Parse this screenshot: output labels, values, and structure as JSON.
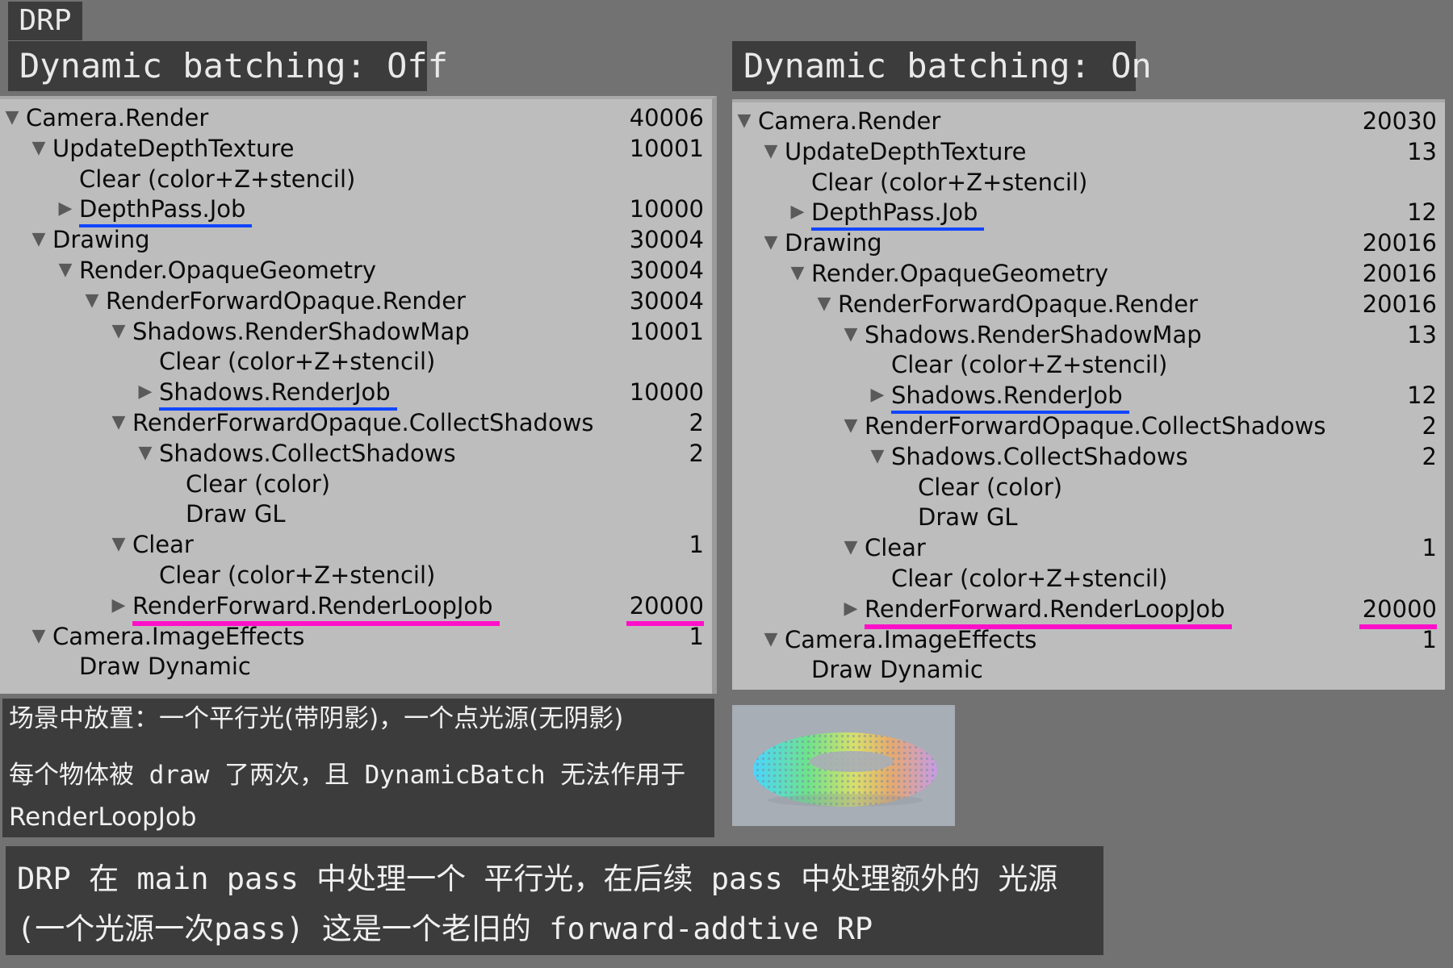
{
  "header": {
    "drp_label": "DRP"
  },
  "panels": [
    {
      "title": "Dynamic batching: Off",
      "rows": [
        {
          "indent": 0,
          "toggle": "expanded",
          "name": "Camera.Render",
          "count": "40006",
          "mark": ""
        },
        {
          "indent": 1,
          "toggle": "expanded",
          "name": "UpdateDepthTexture",
          "count": "10001",
          "mark": ""
        },
        {
          "indent": 2,
          "toggle": "none",
          "name": "Clear (color+Z+stencil)",
          "count": "",
          "mark": ""
        },
        {
          "indent": 2,
          "toggle": "collapsed",
          "name": "DepthPass.Job",
          "count": "10000",
          "mark": "blue"
        },
        {
          "indent": 1,
          "toggle": "expanded",
          "name": "Drawing",
          "count": "30004",
          "mark": ""
        },
        {
          "indent": 2,
          "toggle": "expanded",
          "name": "Render.OpaqueGeometry",
          "count": "30004",
          "mark": ""
        },
        {
          "indent": 3,
          "toggle": "expanded",
          "name": "RenderForwardOpaque.Render",
          "count": "30004",
          "mark": ""
        },
        {
          "indent": 4,
          "toggle": "expanded",
          "name": "Shadows.RenderShadowMap",
          "count": "10001",
          "mark": ""
        },
        {
          "indent": 5,
          "toggle": "none",
          "name": "Clear (color+Z+stencil)",
          "count": "",
          "mark": ""
        },
        {
          "indent": 5,
          "toggle": "collapsed",
          "name": "Shadows.RenderJob",
          "count": "10000",
          "mark": "blue"
        },
        {
          "indent": 4,
          "toggle": "expanded",
          "name": "RenderForwardOpaque.CollectShadows",
          "count": "2",
          "mark": ""
        },
        {
          "indent": 5,
          "toggle": "expanded",
          "name": "Shadows.CollectShadows",
          "count": "2",
          "mark": ""
        },
        {
          "indent": 6,
          "toggle": "none",
          "name": "Clear (color)",
          "count": "",
          "mark": ""
        },
        {
          "indent": 6,
          "toggle": "none",
          "name": "Draw GL",
          "count": "",
          "mark": ""
        },
        {
          "indent": 4,
          "toggle": "expanded",
          "name": "Clear",
          "count": "1",
          "mark": ""
        },
        {
          "indent": 5,
          "toggle": "none",
          "name": "Clear (color+Z+stencil)",
          "count": "",
          "mark": ""
        },
        {
          "indent": 4,
          "toggle": "collapsed",
          "name": "RenderForward.RenderLoopJob",
          "count": "20000",
          "mark": "pink"
        },
        {
          "indent": 1,
          "toggle": "expanded",
          "name": "Camera.ImageEffects",
          "count": "1",
          "mark": ""
        },
        {
          "indent": 2,
          "toggle": "none",
          "name": "Draw Dynamic",
          "count": "",
          "mark": ""
        }
      ]
    },
    {
      "title": "Dynamic batching: On",
      "rows": [
        {
          "indent": 0,
          "toggle": "expanded",
          "name": "Camera.Render",
          "count": "20030",
          "mark": ""
        },
        {
          "indent": 1,
          "toggle": "expanded",
          "name": "UpdateDepthTexture",
          "count": "13",
          "mark": ""
        },
        {
          "indent": 2,
          "toggle": "none",
          "name": "Clear (color+Z+stencil)",
          "count": "",
          "mark": ""
        },
        {
          "indent": 2,
          "toggle": "collapsed",
          "name": "DepthPass.Job",
          "count": "12",
          "mark": "blue"
        },
        {
          "indent": 1,
          "toggle": "expanded",
          "name": "Drawing",
          "count": "20016",
          "mark": ""
        },
        {
          "indent": 2,
          "toggle": "expanded",
          "name": "Render.OpaqueGeometry",
          "count": "20016",
          "mark": ""
        },
        {
          "indent": 3,
          "toggle": "expanded",
          "name": "RenderForwardOpaque.Render",
          "count": "20016",
          "mark": ""
        },
        {
          "indent": 4,
          "toggle": "expanded",
          "name": "Shadows.RenderShadowMap",
          "count": "13",
          "mark": ""
        },
        {
          "indent": 5,
          "toggle": "none",
          "name": "Clear (color+Z+stencil)",
          "count": "",
          "mark": ""
        },
        {
          "indent": 5,
          "toggle": "collapsed",
          "name": "Shadows.RenderJob",
          "count": "12",
          "mark": "blue"
        },
        {
          "indent": 4,
          "toggle": "expanded",
          "name": "RenderForwardOpaque.CollectShadows",
          "count": "2",
          "mark": ""
        },
        {
          "indent": 5,
          "toggle": "expanded",
          "name": "Shadows.CollectShadows",
          "count": "2",
          "mark": ""
        },
        {
          "indent": 6,
          "toggle": "none",
          "name": "Clear (color)",
          "count": "",
          "mark": ""
        },
        {
          "indent": 6,
          "toggle": "none",
          "name": "Draw GL",
          "count": "",
          "mark": ""
        },
        {
          "indent": 4,
          "toggle": "expanded",
          "name": "Clear",
          "count": "1",
          "mark": ""
        },
        {
          "indent": 5,
          "toggle": "none",
          "name": "Clear (color+Z+stencil)",
          "count": "",
          "mark": ""
        },
        {
          "indent": 4,
          "toggle": "collapsed",
          "name": "RenderForward.RenderLoopJob",
          "count": "20000",
          "mark": "pink"
        },
        {
          "indent": 1,
          "toggle": "expanded",
          "name": "Camera.ImageEffects",
          "count": "1",
          "mark": ""
        },
        {
          "indent": 2,
          "toggle": "none",
          "name": "Draw Dynamic",
          "count": "",
          "mark": ""
        }
      ]
    }
  ],
  "notes": {
    "line1": "场景中放置：一个平行光(带阴影)，一个点光源(无阴影)",
    "line2": "每个物体被 draw 了两次，且 DynamicBatch 无法作用于",
    "line3": "RenderLoopJob"
  },
  "bottom": {
    "line1": "DRP 在 main pass 中处理一个 平行光，在后续 pass 中处理额外的 光源",
    "line2": "(一个光源一次pass) 这是一个老旧的 forward-addtive RP"
  },
  "colors": {
    "blue_underline": "#1246ff",
    "pink_underline": "#ff10c8",
    "panel_bg": "#bdbdbd",
    "dark_box": "#3c3c3c"
  },
  "icons": {
    "expanded": "triangle-down-icon",
    "collapsed": "triangle-right-icon"
  }
}
